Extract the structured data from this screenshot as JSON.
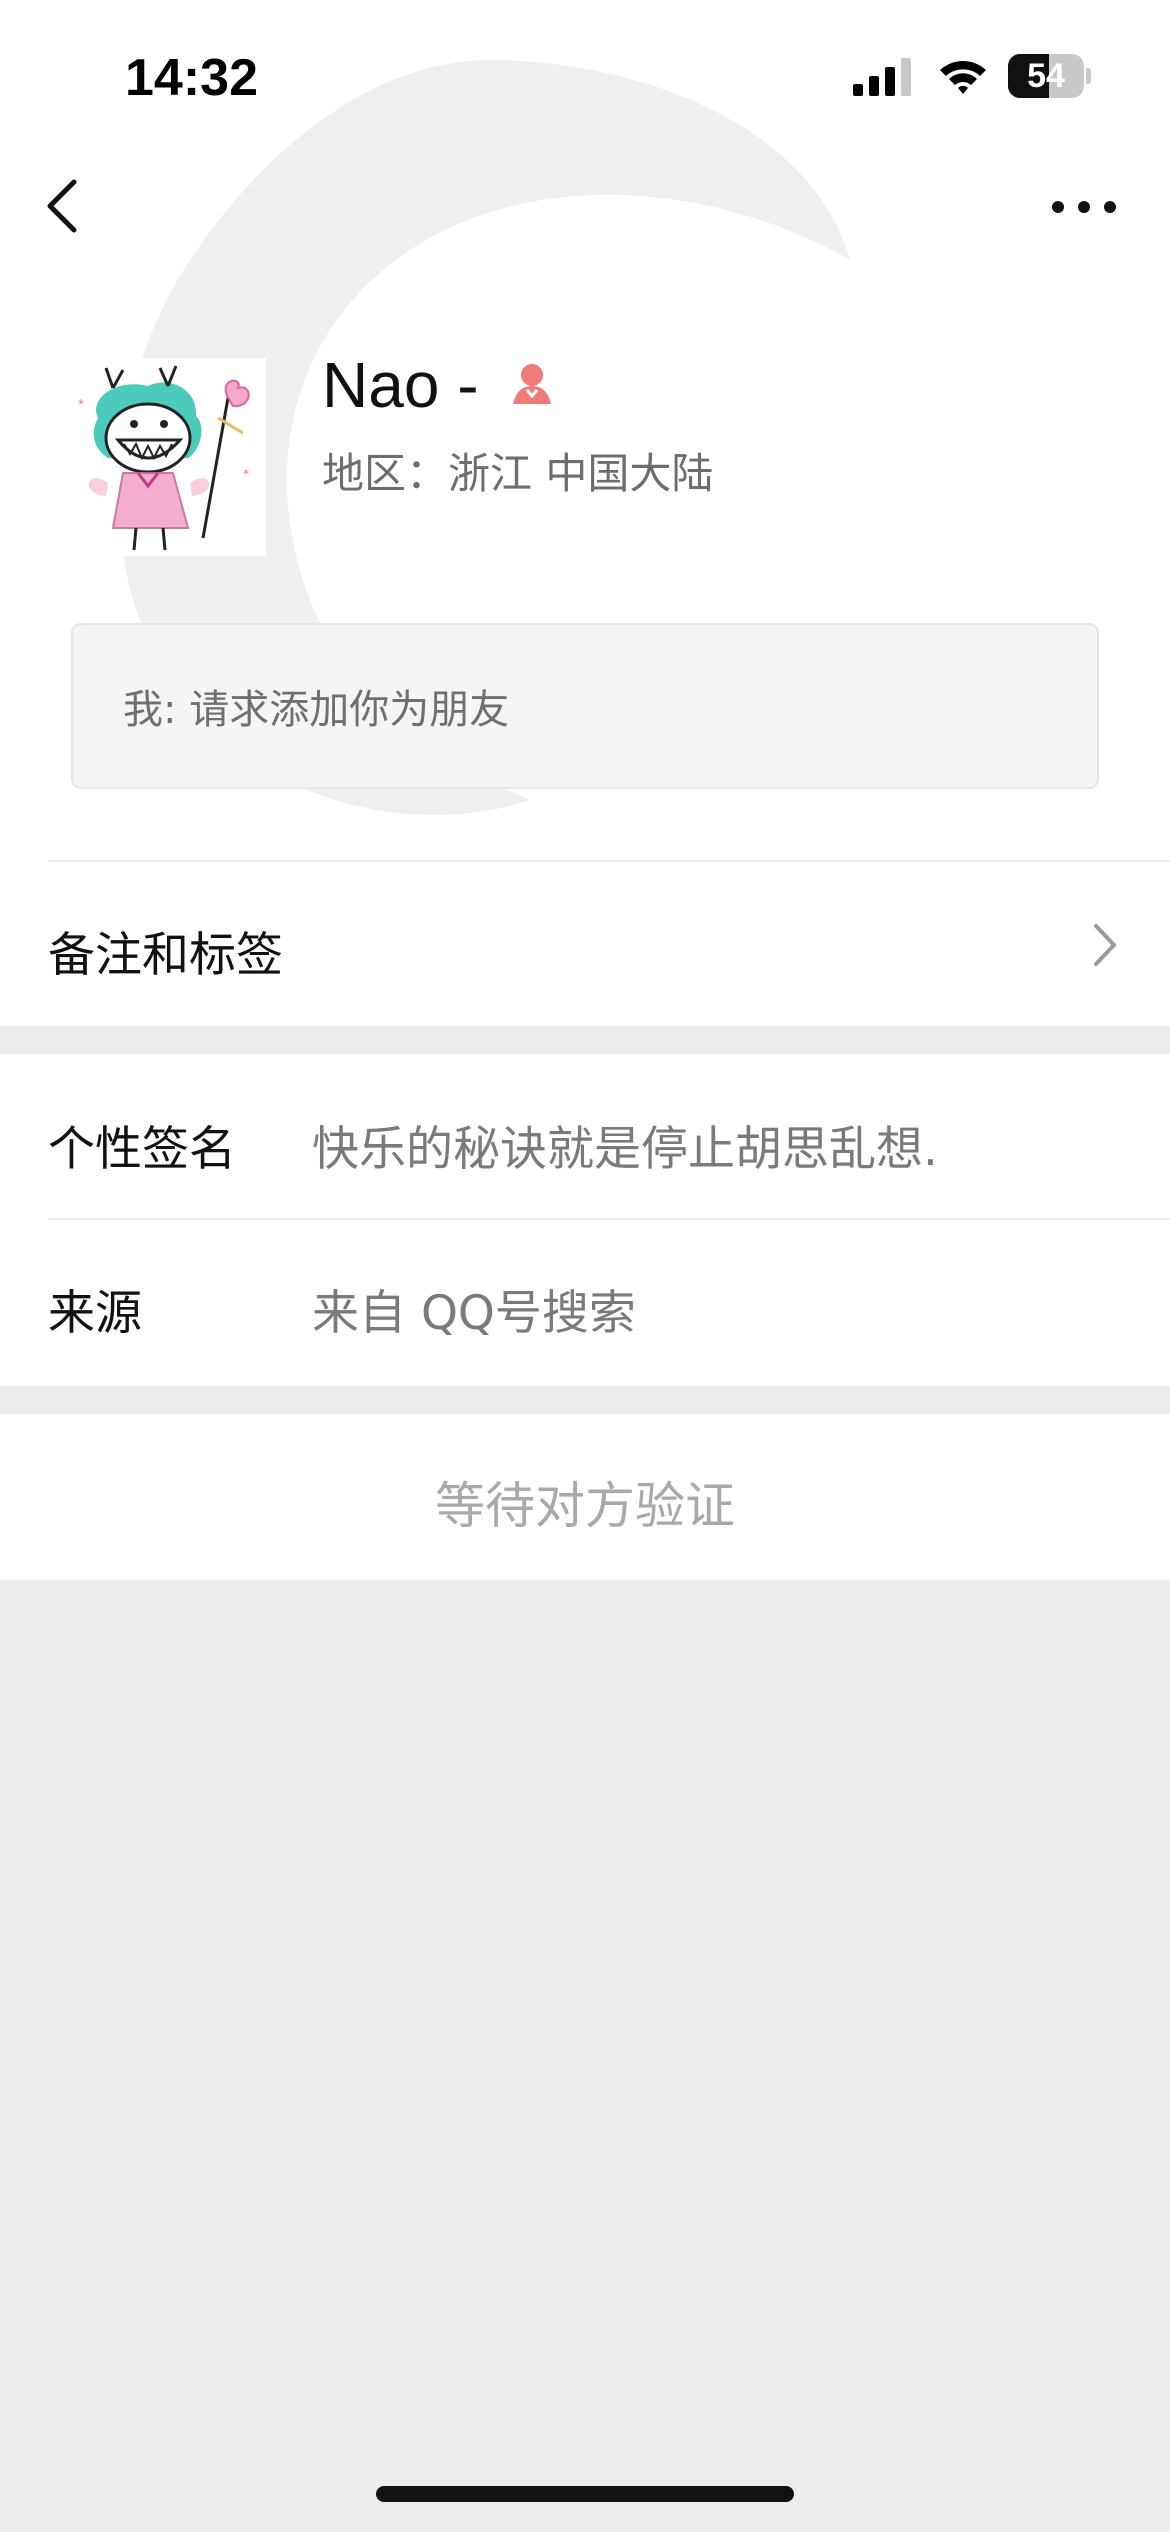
{
  "status_bar": {
    "time": "14:32",
    "battery": "54",
    "battery_level": 0.54
  },
  "nav": {
    "back_icon": "chevron-left-icon",
    "more_icon": "ellipsis-icon"
  },
  "profile": {
    "name": "Nao -",
    "gender_icon": "female-icon",
    "gender_color": "#f07b7b",
    "region": "地区：浙江  中国大陆"
  },
  "request": {
    "text": "我: 请求添加你为朋友"
  },
  "rows": {
    "remark_label": "备注和标签",
    "signature_label": "个性签名",
    "signature_value": "快乐的秘诀就是停止胡思乱想.",
    "source_label": "来源",
    "source_value": "来自 QQ号搜索"
  },
  "action": {
    "status": "等待对方验证"
  }
}
